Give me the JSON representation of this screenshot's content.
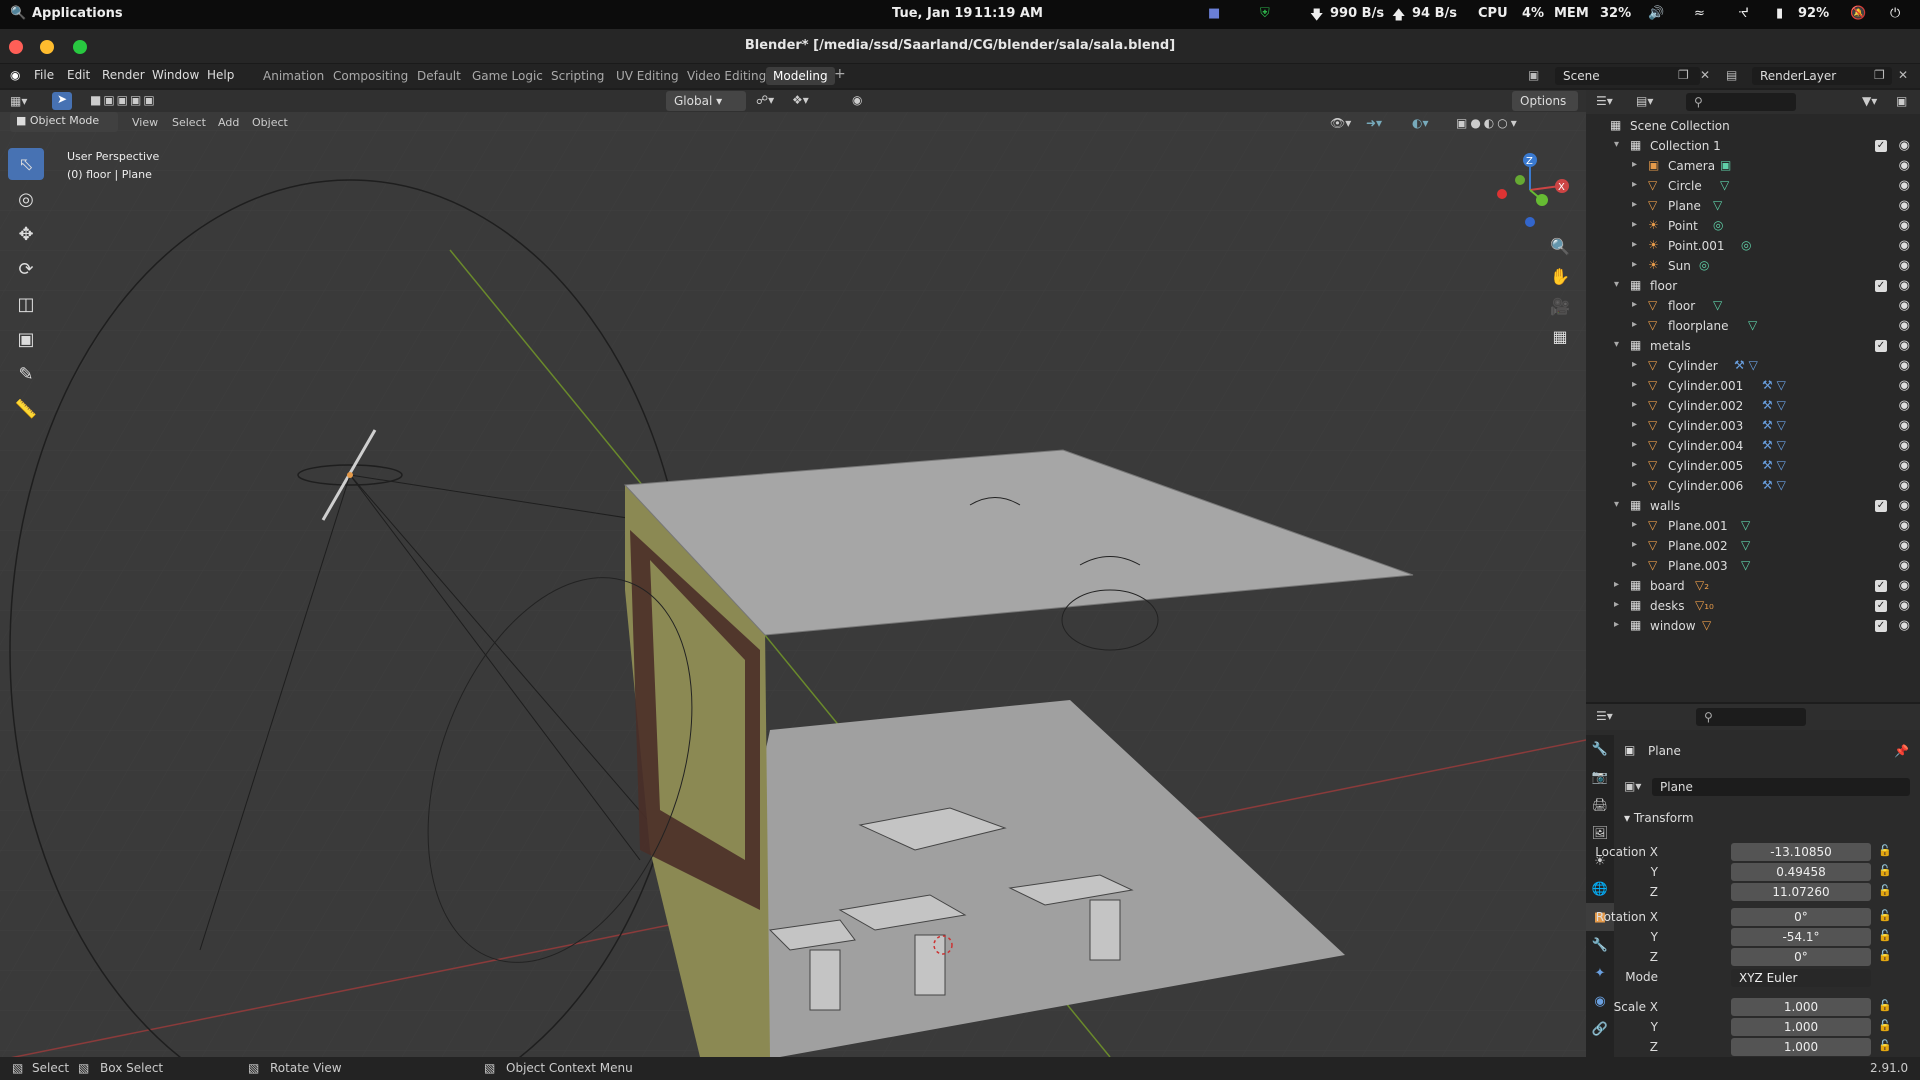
{
  "os_bar": {
    "apps_label": "Applications",
    "date": "Tue, Jan 19",
    "time": "11:19 AM",
    "net_down": "990 B/s",
    "net_up": "94 B/s",
    "cpu_label": "CPU",
    "cpu_value": "4%",
    "mem_label": "MEM",
    "mem_value": "32%",
    "battery": "92%"
  },
  "window": {
    "title": "Blender* [/media/ssd/Saarland/CG/blender/sala/sala.blend]"
  },
  "menu": [
    "File",
    "Edit",
    "Render",
    "Window",
    "Help"
  ],
  "workspaces": [
    "Animation",
    "Compositing",
    "Default",
    "Game Logic",
    "Scripting",
    "UV Editing",
    "Video Editing",
    "Modeling"
  ],
  "active_workspace": "Modeling",
  "scene": {
    "label": "Scene",
    "render_layer": "RenderLayer"
  },
  "viewport_header": {
    "mode": "Object Mode",
    "menus": [
      "View",
      "Select",
      "Add",
      "Object"
    ],
    "orientation": "Global",
    "options": "Options"
  },
  "viewport": {
    "perspective": "User Perspective",
    "active_object": "(0) floor | Plane"
  },
  "outliner": {
    "root": "Scene Collection",
    "rows": [
      {
        "label": "Collection 1",
        "indent": 1,
        "type": "collection",
        "open": true,
        "check": true
      },
      {
        "label": "Camera",
        "indent": 2,
        "type": "object",
        "ext": "cam"
      },
      {
        "label": "Circle",
        "indent": 2,
        "type": "object",
        "ext": "mesh"
      },
      {
        "label": "Plane",
        "indent": 2,
        "type": "object",
        "ext": "mesh"
      },
      {
        "label": "Point",
        "indent": 2,
        "type": "light",
        "ext": "light"
      },
      {
        "label": "Point.001",
        "indent": 2,
        "type": "light",
        "ext": "light"
      },
      {
        "label": "Sun",
        "indent": 2,
        "type": "light",
        "ext": "light"
      },
      {
        "label": "floor",
        "indent": 1,
        "type": "collection",
        "open": true,
        "check": true
      },
      {
        "label": "floor",
        "indent": 2,
        "type": "object",
        "ext": "mesh"
      },
      {
        "label": "floorplane",
        "indent": 2,
        "type": "object",
        "ext": "mesh"
      },
      {
        "label": "metals",
        "indent": 1,
        "type": "collection",
        "open": true,
        "check": true
      },
      {
        "label": "Cylinder",
        "indent": 2,
        "type": "object",
        "ext": "modmesh"
      },
      {
        "label": "Cylinder.001",
        "indent": 2,
        "type": "object",
        "ext": "modmesh"
      },
      {
        "label": "Cylinder.002",
        "indent": 2,
        "type": "object",
        "ext": "modmesh"
      },
      {
        "label": "Cylinder.003",
        "indent": 2,
        "type": "object",
        "ext": "modmesh"
      },
      {
        "label": "Cylinder.004",
        "indent": 2,
        "type": "object",
        "ext": "modmesh"
      },
      {
        "label": "Cylinder.005",
        "indent": 2,
        "type": "object",
        "ext": "modmesh"
      },
      {
        "label": "Cylinder.006",
        "indent": 2,
        "type": "object",
        "ext": "modmesh"
      },
      {
        "label": "walls",
        "indent": 1,
        "type": "collection",
        "open": true,
        "check": true
      },
      {
        "label": "Plane.001",
        "indent": 2,
        "type": "object",
        "ext": "mesh"
      },
      {
        "label": "Plane.002",
        "indent": 2,
        "type": "object",
        "ext": "mesh"
      },
      {
        "label": "Plane.003",
        "indent": 2,
        "type": "object",
        "ext": "mesh"
      },
      {
        "label": "board",
        "indent": 1,
        "type": "collection",
        "open": false,
        "check": true,
        "ext": "obj2"
      },
      {
        "label": "desks",
        "indent": 1,
        "type": "collection",
        "open": false,
        "check": true,
        "ext": "obj10"
      },
      {
        "label": "window",
        "indent": 1,
        "type": "collection",
        "open": false,
        "check": true,
        "ext": "obj"
      }
    ]
  },
  "properties": {
    "object_name": "Plane",
    "datablock": "Plane",
    "section": "Transform",
    "location_label": "Location X",
    "location": [
      "-13.10850",
      "0.49458",
      "11.07260"
    ],
    "rotation_label": "Rotation X",
    "rotation": [
      "0°",
      "-54.1°",
      "0°"
    ],
    "mode_label": "Mode",
    "mode": "XYZ Euler",
    "scale_label": "Scale X",
    "scale": [
      "1.000",
      "1.000",
      "1.000"
    ],
    "axis_y": "Y",
    "axis_z": "Z"
  },
  "status": {
    "select": "Select",
    "box_select": "Box Select",
    "rotate": "Rotate View",
    "context": "Object Context Menu",
    "version": "2.91.0"
  },
  "colors": {
    "accent": "#4772b3",
    "active_tab": "#3d3d3d",
    "object_orange": "#e59a4a",
    "data_green": "#5fd0a8"
  }
}
